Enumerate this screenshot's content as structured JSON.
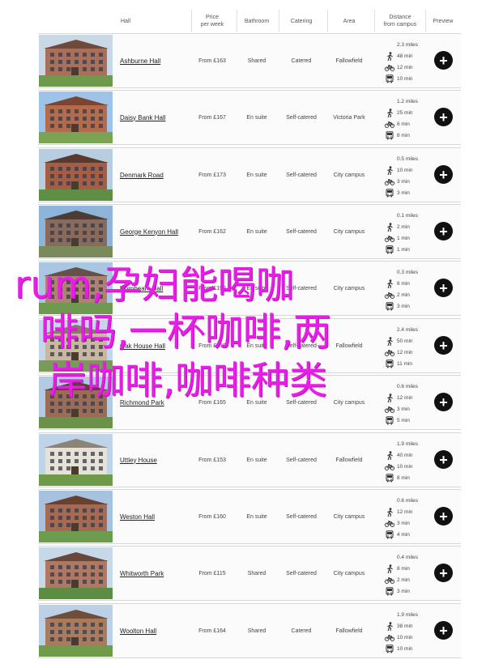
{
  "header": {
    "hall": "Hall",
    "price_line1": "Price",
    "price_line2": "per week",
    "bathroom": "Bathroom",
    "catering": "Catering",
    "area": "Area",
    "distance_line1": "Distance",
    "distance_line2": "from campus",
    "preview": "Preview"
  },
  "rows": [
    {
      "name": "Ashburne Hall",
      "price": "From £163",
      "bathroom": "Shared",
      "catering": "Catered",
      "area": "Fallowfield",
      "miles": "2.3 miles",
      "walk": "48 min",
      "bike": "12 min",
      "bus": "10 min"
    },
    {
      "name": "Daisy Bank Hall",
      "price": "From £167",
      "bathroom": "En suite",
      "catering": "Self-catered",
      "area": "Victoria Park",
      "miles": "1.2 miles",
      "walk": "25 min",
      "bike": "6 min",
      "bus": "8 min"
    },
    {
      "name": "Denmark Road",
      "price": "From £173",
      "bathroom": "En suite",
      "catering": "Self-catered",
      "area": "City campus",
      "miles": "0.5 miles",
      "walk": "10 min",
      "bike": "3 min",
      "bus": "3 min"
    },
    {
      "name": "George Kenyon Hall",
      "price": "From £162",
      "bathroom": "En suite",
      "catering": "Self-catered",
      "area": "City campus",
      "miles": "0.1 miles",
      "walk": "2 min",
      "bike": "1 min",
      "bus": "1 min"
    },
    {
      "name": "Hornbeam Hall",
      "price": "From £159",
      "bathroom": "En suite",
      "catering": "Self-catered",
      "area": "City campus",
      "miles": "0.3 miles",
      "walk": "6 min",
      "bike": "2 min",
      "bus": "3 min"
    },
    {
      "name": "Oak House Hall",
      "price": "From £150",
      "bathroom": "En suite",
      "catering": "Self-catered",
      "area": "Fallowfield",
      "miles": "2.4 miles",
      "walk": "50 min",
      "bike": "12 min",
      "bus": "11 min"
    },
    {
      "name": "Richmond Park",
      "price": "From £165",
      "bathroom": "En suite",
      "catering": "Self-catered",
      "area": "City campus",
      "miles": "0.6 miles",
      "walk": "12 min",
      "bike": "3 min",
      "bus": "5 min"
    },
    {
      "name": "Uttley House",
      "price": "From £153",
      "bathroom": "En suite",
      "catering": "Self-catered",
      "area": "Fallowfield",
      "miles": "1.9 miles",
      "walk": "40 min",
      "bike": "10 min",
      "bus": "8 min"
    },
    {
      "name": "Weston Hall",
      "price": "From £160",
      "bathroom": "En suite",
      "catering": "Self-catered",
      "area": "City campus",
      "miles": "0.6 miles",
      "walk": "12 min",
      "bike": "3 min",
      "bus": "4 min"
    },
    {
      "name": "Whitworth Park",
      "price": "From £115",
      "bathroom": "Shared",
      "catering": "Self-catered",
      "area": "City campus",
      "miles": "0.4 miles",
      "walk": "8 min",
      "bike": "2 min",
      "bus": "3 min"
    },
    {
      "name": "Woolton Hall",
      "price": "From £164",
      "bathroom": "Shared",
      "catering": "Catered",
      "area": "Fallowfield",
      "miles": "1.9 miles",
      "walk": "38 min",
      "bike": "10 min",
      "bus": "10 min"
    }
  ],
  "overlay": {
    "line1": "rum,孕妇能喝咖",
    "line2": "啡吗,一杯咖啡,两",
    "line3": "岸咖啡,咖啡种类"
  },
  "colors": {
    "overlay": "#e61ee6",
    "preview_button": "#111111"
  },
  "icons": {
    "walk": "walking-person-icon",
    "bike": "bicycle-icon",
    "bus": "bus-icon",
    "preview": "plus-circle-icon"
  }
}
